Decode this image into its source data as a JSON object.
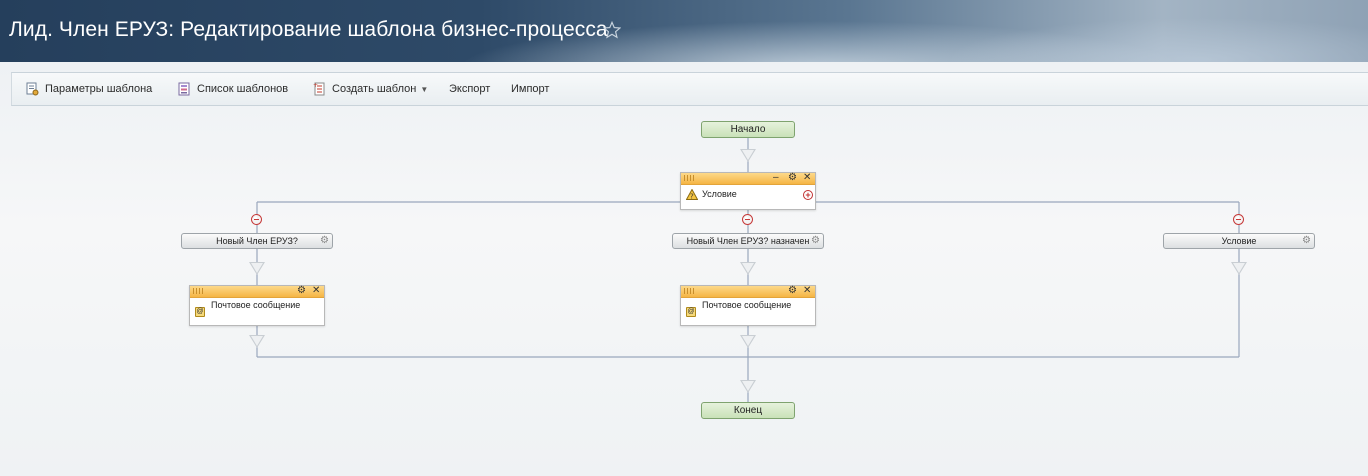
{
  "header": {
    "title": "Лид. Член ЕРУЗ: Редактирование шаблона бизнес-процесса",
    "star_icon": "star-icon"
  },
  "toolbar": {
    "items": [
      {
        "label": "Параметры шаблона",
        "icon": "template-settings-icon"
      },
      {
        "label": "Список шаблонов",
        "icon": "template-list-icon"
      },
      {
        "label": "Создать шаблон",
        "icon": "create-template-icon"
      },
      {
        "label": "Экспорт"
      },
      {
        "label": "Импорт"
      }
    ]
  },
  "workflow": {
    "start_label": "Начало",
    "end_label": "Конец",
    "condition_activity": {
      "label": "Условие",
      "icon": "condition-icon",
      "controls": [
        "minimize-icon",
        "gear-icon",
        "close-icon"
      ],
      "add_branch_icon": "add-branch-icon"
    },
    "branches": [
      {
        "condition_label": "Новый Член ЕРУЗ?",
        "activity_label": "Почтовое сообщение",
        "activity_icon": "mail-icon"
      },
      {
        "condition_label": "Новый Член ЕРУЗ? назначен",
        "activity_label": "Почтовое сообщение",
        "activity_icon": "mail-icon"
      },
      {
        "condition_label": "Условие"
      }
    ],
    "colors": {
      "connector": "#9aa7bd",
      "activity_header": "#f5b545",
      "terminal": "#c9e1b8",
      "remove_branch": "#c63a3a"
    }
  }
}
